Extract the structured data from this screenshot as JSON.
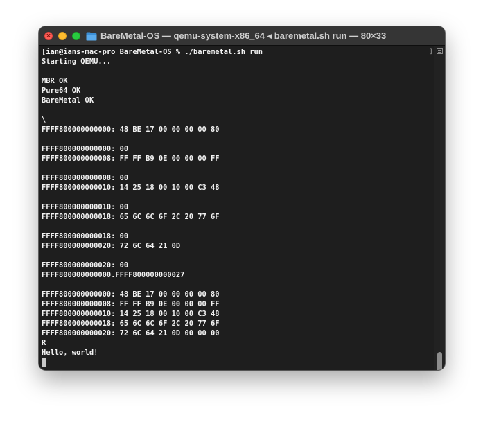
{
  "window": {
    "title": "BareMetal-OS — qemu-system-x86_64 ◂ baremetal.sh run — 80×33",
    "traffic_lights": [
      "close",
      "minimize",
      "zoom"
    ],
    "title_icon": "folder-icon",
    "close_glyph": "×"
  },
  "terminal": {
    "right_mark": "]",
    "lines": [
      "[ian@ians-mac-pro BareMetal-OS % ./baremetal.sh run",
      "Starting QEMU...",
      "",
      "MBR OK",
      "Pure64 OK",
      "BareMetal OK",
      "",
      "\\",
      "FFFF800000000000: 48 BE 17 00 00 00 00 80",
      "",
      "FFFF800000000000: 00",
      "FFFF800000000008: FF FF B9 0E 00 00 00 FF",
      "",
      "FFFF800000000008: 00",
      "FFFF800000000010: 14 25 18 00 10 00 C3 48",
      "",
      "FFFF800000000010: 00",
      "FFFF800000000018: 65 6C 6C 6F 2C 20 77 6F",
      "",
      "FFFF800000000018: 00",
      "FFFF800000000020: 72 6C 64 21 0D",
      "",
      "FFFF800000000020: 00",
      "FFFF800000000000.FFFF800000000027",
      "",
      "FFFF800000000000: 48 BE 17 00 00 00 00 80",
      "FFFF800000000008: FF FF B9 0E 00 00 00 FF",
      "FFFF800000000010: 14 25 18 00 10 00 C3 48",
      "FFFF800000000018: 65 6C 6C 6F 2C 20 77 6F",
      "FFFF800000000020: 72 6C 64 21 0D 00 00 00",
      "R",
      "Hello, world!"
    ]
  },
  "colors": {
    "background": "#1e1e1e",
    "text": "#f2f2f2",
    "titlebar": "#353535",
    "close": "#fe5f57",
    "minimize": "#febc2e",
    "zoom": "#28c840",
    "folder": "#4a9fe0"
  }
}
